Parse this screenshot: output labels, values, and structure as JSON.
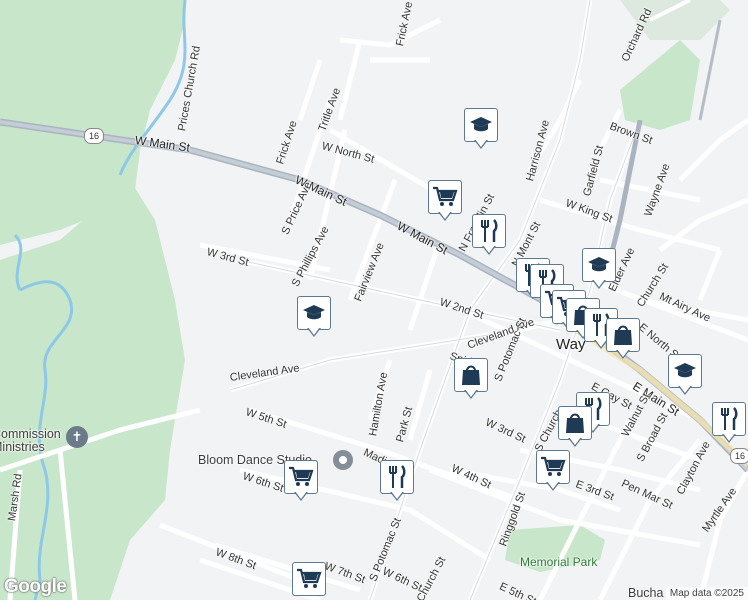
{
  "map": {
    "colors": {
      "background": "#f1f3f4",
      "park": "#c8e6c9",
      "road": "#ffffff",
      "highway": "#aab4c0",
      "river": "#8ec8e8",
      "pin_border": "#5f7891",
      "icon": "#1f3a55"
    },
    "streets": [
      {
        "name": "Frick Ave"
      },
      {
        "name": "Orchard Rd"
      },
      {
        "name": "Prices Church Rd"
      },
      {
        "name": "Tritle Ave"
      },
      {
        "name": "Frick Ave"
      },
      {
        "name": "W North St"
      },
      {
        "name": "W Main St"
      },
      {
        "name": "W Main St"
      },
      {
        "name": "W Main St"
      },
      {
        "name": "Brown St"
      },
      {
        "name": "Harrison Ave"
      },
      {
        "name": "Garfield St"
      },
      {
        "name": "Wayne Ave"
      },
      {
        "name": "W King St"
      },
      {
        "name": "S Price Ave"
      },
      {
        "name": "S Phillips Ave"
      },
      {
        "name": "Fairview Ave"
      },
      {
        "name": "W 3rd St"
      },
      {
        "name": "W 2nd St"
      },
      {
        "name": "Cleveland Ave"
      },
      {
        "name": "Cleveland Ave"
      },
      {
        "name": "S Potomac St"
      },
      {
        "name": "Hamilton Ave"
      },
      {
        "name": "W 5th St"
      },
      {
        "name": "Park St"
      },
      {
        "name": "W 3rd St"
      },
      {
        "name": "E Main St"
      },
      {
        "name": "Walnut St"
      },
      {
        "name": "S Broad St"
      },
      {
        "name": "W 4th St"
      },
      {
        "name": "E 3rd St"
      },
      {
        "name": "Pen Mar St"
      },
      {
        "name": "Clayton Ave"
      },
      {
        "name": "Myrtle Ave"
      },
      {
        "name": "W 6th St"
      },
      {
        "name": "S Potomac St"
      },
      {
        "name": "Ringgold St"
      },
      {
        "name": "W 8th St"
      },
      {
        "name": "W 6th St"
      },
      {
        "name": "E 5th St"
      },
      {
        "name": "Marsh Rd"
      },
      {
        "name": "Elder Ave"
      },
      {
        "name": "Mt Airy Ave"
      },
      {
        "name": "E North St"
      },
      {
        "name": "Madison"
      },
      {
        "name": "Snider"
      },
      {
        "name": "E Gay St"
      },
      {
        "name": "Church St"
      },
      {
        "name": "N Mont St"
      },
      {
        "name": "N Franklin St"
      },
      {
        "name": "Church St"
      },
      {
        "name": "W 7th St"
      },
      {
        "name": "S Church"
      }
    ],
    "town_label": "Way",
    "places": {
      "commission": "Commission\nMinistries",
      "bloom": "Bloom Dance Studio",
      "memorial_park": "Memorial Park",
      "bucha": "Bucha"
    },
    "route_shields": [
      "16",
      "16"
    ],
    "branding": "Google",
    "attribution": "Map data ©2025"
  }
}
